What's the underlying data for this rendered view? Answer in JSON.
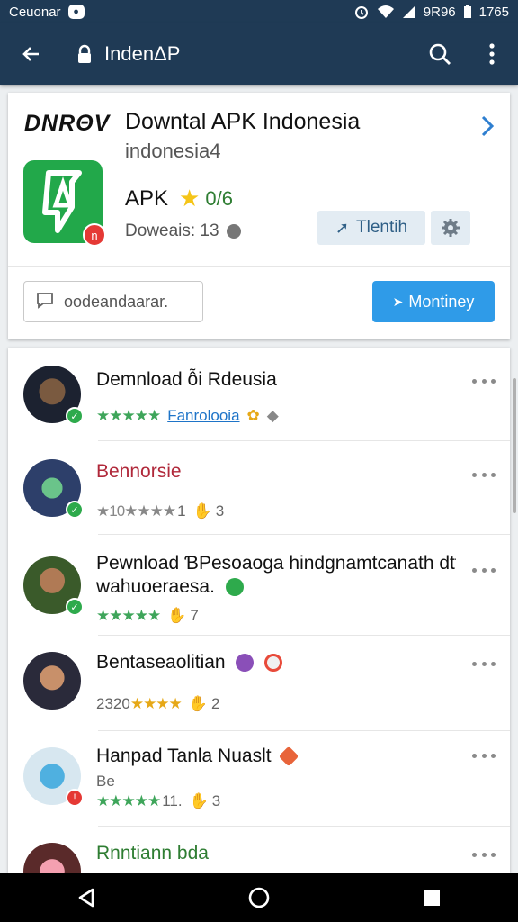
{
  "status_bar": {
    "carrier": "Ceuonar",
    "chat_icon": "chat-bubble-icon",
    "signal": "9R96",
    "time": "1765"
  },
  "app_bar": {
    "title": "IndenΔP",
    "icons": [
      "back-arrow-icon",
      "lock-icon",
      "search-icon",
      "more-vert-icon"
    ]
  },
  "app_card": {
    "brand": "DNRΘV",
    "title": "Downtal APK Indonesia",
    "subtitle": "indonesia4",
    "icon_badge": "n",
    "type_label": "APK",
    "rating_suffix": "0/6",
    "downloads": "Doweais: 13",
    "primary_button": "Tlentih",
    "search_placeholder": "oodeandaarar.",
    "action_button": "Montiney",
    "colors": {
      "accent": "#2f9be8",
      "header": "#1f3a55",
      "app_icon": "#22a84a"
    }
  },
  "list": [
    {
      "title": "Demnload ỗi Rdeusia",
      "stars": "★★★★★",
      "link": "Fanrolooia",
      "title_color": "default"
    },
    {
      "title": "Bennorsie",
      "meta_prefix": "★10",
      "stars": "★★★★",
      "meta_tail": "1",
      "count": "3",
      "title_color": "red"
    },
    {
      "title": "Pewnload ƁPesoaoga hindgnamtcanath dtf",
      "title2": "wahuoeraesa.",
      "stars": "★★★★★",
      "count": "7"
    },
    {
      "title": "Bentaseaolitian",
      "meta_prefix": "2320",
      "stars": "★★★★",
      "count": "2"
    },
    {
      "title": "Hanpad Tanla Nuaslt",
      "subtitle": "Be",
      "stars": "★★★★★",
      "meta_tail": "11.",
      "count": "3"
    },
    {
      "title": "Rnntiann bda",
      "title_color": "green"
    }
  ],
  "nav_bar": {
    "icons": [
      "back-triangle-icon",
      "home-circle-icon",
      "recents-square-icon"
    ]
  }
}
